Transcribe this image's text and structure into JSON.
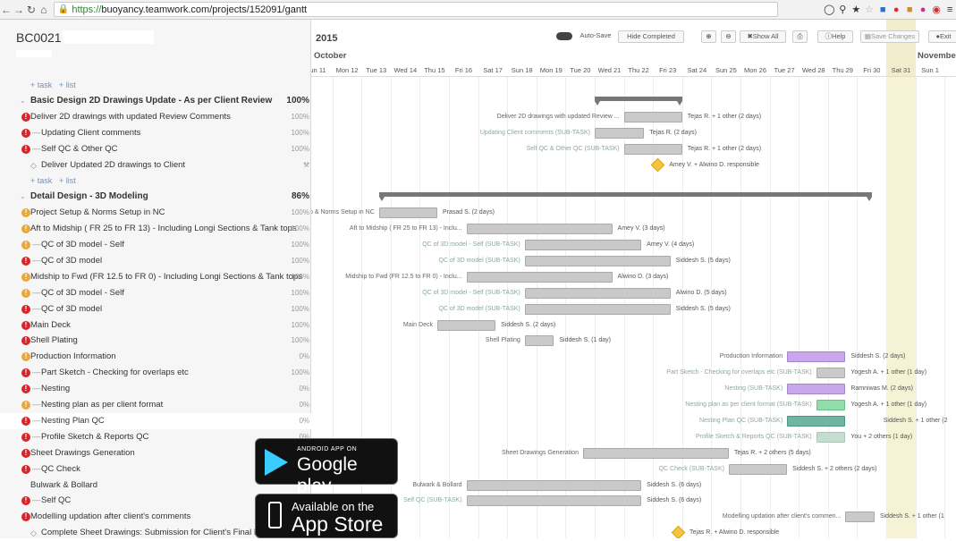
{
  "browser": {
    "url_protocol": "https://",
    "url_rest": "buoyancy.teamwork.com/projects/152091/gantt"
  },
  "project": {
    "code": "BC0021 -"
  },
  "toolbar": {
    "autosave": "Auto-Save",
    "hide_completed": "Hide Completed",
    "show_all": "Show All",
    "help": "Help",
    "save_changes": "Save Changes",
    "exit": "Exit"
  },
  "timeline": {
    "year": "2015",
    "month": "October",
    "next_month": "November",
    "days": [
      "un 11",
      "Mon 12",
      "Tue 13",
      "Wed 14",
      "Thu 15",
      "Fri 16",
      "Sat 17",
      "Sun 18",
      "Mon 19",
      "Tue 20",
      "Wed 21",
      "Thu 22",
      "Fri 23",
      "Sat 24",
      "Sun 25",
      "Mon 26",
      "Tue 27",
      "Wed 28",
      "Thu 29",
      "Fri 30",
      "Sat 31",
      "Sun 1",
      "M"
    ]
  },
  "tasklist": {
    "add_task": "+ task",
    "add_list": "+ list",
    "rows": [
      {
        "type": "links"
      },
      {
        "type": "section",
        "label": "Basic Design 2D Drawings Update - As per Client Review",
        "pct": "100%"
      },
      {
        "type": "task",
        "icon": "red",
        "label": "Deliver 2D drawings with updated Review Comments",
        "pct": "100%",
        "indent": 0
      },
      {
        "type": "task",
        "icon": "red",
        "label": "Updating Client comments",
        "pct": "100%",
        "indent": 1
      },
      {
        "type": "task",
        "icon": "red",
        "label": "Self QC & Other QC",
        "pct": "100%",
        "indent": 1
      },
      {
        "type": "milestone",
        "label": "Deliver Updated 2D drawings to Client",
        "pct": ""
      },
      {
        "type": "links"
      },
      {
        "type": "section",
        "label": "Detail Design - 3D Modeling",
        "pct": "86%"
      },
      {
        "type": "task",
        "icon": "yel",
        "label": "Project Setup & Norms Setup in NC",
        "pct": "100%",
        "indent": 0
      },
      {
        "type": "task",
        "icon": "yel",
        "label": "Aft to Midship ( FR 25 to FR 13) - Including Longi Sections & Tank tops",
        "pct": "100%",
        "indent": 0
      },
      {
        "type": "task",
        "icon": "yel",
        "label": "QC of 3D model - Self",
        "pct": "100%",
        "indent": 1
      },
      {
        "type": "task",
        "icon": "red",
        "label": "QC of 3D model",
        "pct": "100%",
        "indent": 1
      },
      {
        "type": "task",
        "icon": "yel",
        "label": "Midship to Fwd (FR 12.5 to FR 0) - Including Longi Sections & Tank tops",
        "pct": "100%",
        "indent": 0
      },
      {
        "type": "task",
        "icon": "yel",
        "label": "QC of 3D model - Self",
        "pct": "100%",
        "indent": 1
      },
      {
        "type": "task",
        "icon": "red",
        "label": "QC of 3D model",
        "pct": "100%",
        "indent": 1
      },
      {
        "type": "task",
        "icon": "red",
        "label": "Main Deck",
        "pct": "100%",
        "indent": 0
      },
      {
        "type": "task",
        "icon": "red",
        "label": "Shell Plating",
        "pct": "100%",
        "indent": 0
      },
      {
        "type": "task",
        "icon": "yel",
        "label": "Production Information",
        "pct": "0%",
        "indent": 0
      },
      {
        "type": "task",
        "icon": "red",
        "label": "Part Sketch - Checking for overlaps etc",
        "pct": "100%",
        "indent": 1
      },
      {
        "type": "task",
        "icon": "red",
        "label": "Nesting",
        "pct": "0%",
        "indent": 1
      },
      {
        "type": "task",
        "icon": "yel",
        "label": "Nesting plan as per client format",
        "pct": "0%",
        "indent": 1
      },
      {
        "type": "task",
        "icon": "red",
        "label": "Nesting Plan QC",
        "pct": "0%",
        "indent": 1,
        "hl": true
      },
      {
        "type": "task",
        "icon": "red",
        "label": "Profile Sketch & Reports QC",
        "pct": "0%",
        "indent": 1
      },
      {
        "type": "task",
        "icon": "red",
        "label": "Sheet Drawings Generation",
        "pct": "",
        "indent": 0
      },
      {
        "type": "task",
        "icon": "red",
        "label": "QC Check",
        "pct": "",
        "indent": 1
      },
      {
        "type": "task",
        "icon": "none",
        "label": "Bulwark & Bollard",
        "pct": "",
        "indent": 0
      },
      {
        "type": "task",
        "icon": "red",
        "label": "Self QC",
        "pct": "",
        "indent": 1
      },
      {
        "type": "task",
        "icon": "red",
        "label": "Modelling updation after client's comments",
        "pct": "",
        "indent": 0
      },
      {
        "type": "milestone",
        "label": "Complete Sheet Drawings: Submission for Client's Final Review",
        "pct": ""
      }
    ]
  },
  "gantt": {
    "rows": [
      null,
      {
        "summary": [
          10,
          13
        ]
      },
      {
        "bars": [
          {
            "c": "grey",
            "s": 11,
            "e": 13
          }
        ],
        "left": "Deliver 2D drawings with updated Review ...",
        "right": "Tejas R. + 1 other (2 days)"
      },
      {
        "bars": [
          {
            "c": "grey",
            "s": 10,
            "e": 11.7
          }
        ],
        "left": "Updating Client comments (SUB-TASK)",
        "right": "Tejas R. (2 days)",
        "sub": true
      },
      {
        "bars": [
          {
            "c": "grey",
            "s": 11,
            "e": 13
          }
        ],
        "left": "Self QC & Other QC (SUB-TASK)",
        "right": "Tejas R. + 1 other (2 days)",
        "sub": true
      },
      {
        "milestone": 12,
        "right": "Amey V. + Alwino D. responsible"
      },
      null,
      {
        "summary": [
          2.6,
          19.5
        ]
      },
      {
        "bars": [
          {
            "c": "grey",
            "s": 2.6,
            "e": 4.6
          }
        ],
        "left": "etup & Norms Setup in NC",
        "right": "Prasad S. (2 days)"
      },
      {
        "bars": [
          {
            "c": "grey",
            "s": 5.6,
            "e": 10.6
          }
        ],
        "left": "Aft to Midship ( FR 25 to FR 13) - Inclu...",
        "right": "Amey V. (3 days)"
      },
      {
        "bars": [
          {
            "c": "grey",
            "s": 7.6,
            "e": 11.6
          }
        ],
        "left": "QC of 3D model - Self (SUB-TASK)",
        "right": "Amey V. (4 days)",
        "sub": true
      },
      {
        "bars": [
          {
            "c": "grey",
            "s": 7.6,
            "e": 12.6
          }
        ],
        "left": "QC of 3D model (SUB-TASK)",
        "right": "Siddesh S. (5 days)",
        "sub": true
      },
      {
        "bars": [
          {
            "c": "grey",
            "s": 5.6,
            "e": 10.6
          }
        ],
        "left": "Midship to Fwd (FR 12.5 to FR 0) - Inclu...",
        "right": "Alwino D. (3 days)"
      },
      {
        "bars": [
          {
            "c": "grey",
            "s": 7.6,
            "e": 12.6
          }
        ],
        "left": "QC of 3D model - Self (SUB-TASK)",
        "right": "Alwino D. (5 days)",
        "sub": true
      },
      {
        "bars": [
          {
            "c": "grey",
            "s": 7.6,
            "e": 12.6
          }
        ],
        "left": "QC of 3D model (SUB-TASK)",
        "right": "Siddesh S. (5 days)",
        "sub": true
      },
      {
        "bars": [
          {
            "c": "grey",
            "s": 4.6,
            "e": 6.6
          }
        ],
        "left": "Main Deck",
        "right": "Siddesh S. (2 days)"
      },
      {
        "bars": [
          {
            "c": "grey",
            "s": 7.6,
            "e": 8.6
          }
        ],
        "left": "Shell Plating",
        "right": "Siddesh S. (1 day)"
      },
      {
        "bars": [
          {
            "c": "purple",
            "s": 16.6,
            "e": 18.6
          }
        ],
        "left": "Production Information",
        "right": "Siddesh S. (2 days)"
      },
      {
        "bars": [
          {
            "c": "grey",
            "s": 17.6,
            "e": 18.6
          }
        ],
        "left": "Part Sketch - Checking for overlaps etc (SUB-TASK)",
        "right": "Yogesh A. + 1 other (1 day)",
        "sub": true
      },
      {
        "bars": [
          {
            "c": "purple",
            "s": 16.6,
            "e": 18.6
          }
        ],
        "left": "Nesting (SUB-TASK)",
        "right": "Ramniwas M. (2 days)",
        "sub": true
      },
      {
        "bars": [
          {
            "c": "green",
            "s": 17.6,
            "e": 18.6
          }
        ],
        "left": "Nesting plan as per client format (SUB-TASK)",
        "right": "Yogesh A. + 1 other (1 day)",
        "sub": true
      },
      {
        "bars": [
          {
            "c": "teal",
            "s": 16.6,
            "e": 18.6
          }
        ],
        "left": "Nesting Plan QC (SUB-TASK)",
        "right": "Siddesh S. + 1 other (2",
        "sub": true,
        "rightx": 19.9
      },
      {
        "bars": [
          {
            "c": "lgreen",
            "s": 17.6,
            "e": 18.6
          }
        ],
        "left": "Profile Sketch & Reports QC (SUB-TASK)",
        "right": "You + 2 others (1 day)",
        "sub": true
      },
      {
        "bars": [
          {
            "c": "grey",
            "s": 9.6,
            "e": 14.6
          }
        ],
        "left": "Sheet Drawings Generation",
        "right": "Tejas R. + 2 others (5 days)"
      },
      {
        "bars": [
          {
            "c": "grey",
            "s": 14.6,
            "e": 16.6
          }
        ],
        "left": "QC Check (SUB-TASK)",
        "right": "Siddesh S. + 2 others (2 days)",
        "sub": true
      },
      {
        "bars": [
          {
            "c": "grey",
            "s": 5.6,
            "e": 11.6
          }
        ],
        "left": "Bulwark & Bollard",
        "right": "Siddesh S. (6 days)"
      },
      {
        "bars": [
          {
            "c": "grey",
            "s": 5.6,
            "e": 11.6
          }
        ],
        "left": "Self QC (SUB-TASK)",
        "right": "Siddesh S. (6 days)",
        "sub": true
      },
      {
        "bars": [
          {
            "c": "grey",
            "s": 18.6,
            "e": 19.6
          }
        ],
        "left": "Modelling updation after client's commen...",
        "right": "Siddesh S. + 1 other (1"
      },
      {
        "milestone": 12.7,
        "right": "Tejas R. + Alwino D. responsible"
      }
    ]
  },
  "badges": {
    "google_small": "ANDROID APP ON",
    "google_big": "Google play",
    "apple_small": "Available on the",
    "apple_big": "App Store"
  }
}
